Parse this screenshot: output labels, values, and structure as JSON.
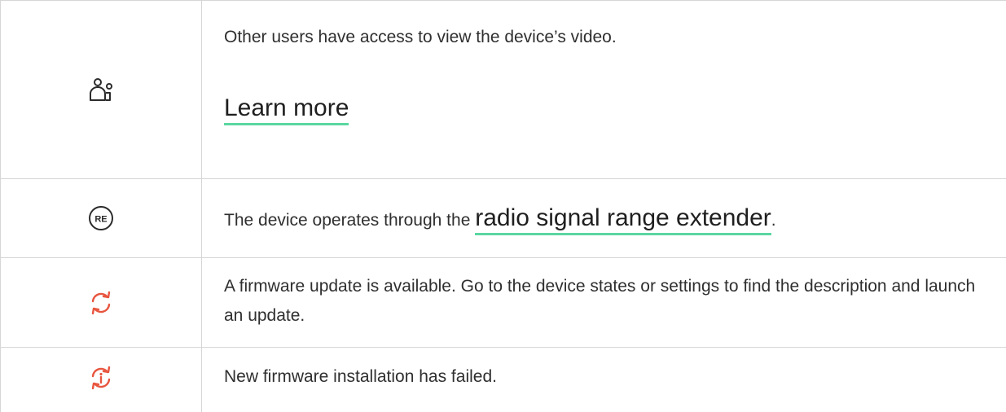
{
  "rows": [
    {
      "icon": "shared-users-icon",
      "text": "Other users have access to view the device’s video.",
      "link": "Learn more"
    },
    {
      "icon": "re-badge-icon",
      "icon_label": "RE",
      "text_before": "The device operates through the ",
      "link": "radio signal range extender",
      "text_after": "."
    },
    {
      "icon": "refresh-arrows-icon",
      "text": "A firmware update is available. Go to the device states or settings to find the description and launch an update."
    },
    {
      "icon": "info-refresh-icon",
      "text": "New firmware installation has failed."
    }
  ],
  "colors": {
    "link_underline": "#5ad7a1",
    "accent": "#e8563f",
    "border": "#d6d6d6"
  }
}
